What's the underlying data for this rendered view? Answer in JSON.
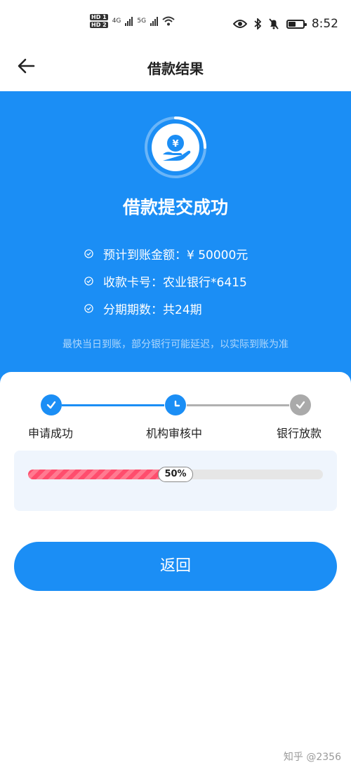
{
  "status_bar": {
    "hd1": "HD 1",
    "hd2": "HD 2",
    "net1": "4G",
    "net2": "5G",
    "time": "8:52",
    "battery_level": 0.45
  },
  "nav": {
    "title": "借款结果",
    "back_icon": "arrow-left-icon"
  },
  "hero": {
    "icon": "yen-hand-icon",
    "title": "借款提交成功",
    "details": [
      {
        "label": "预计到账金额：",
        "value": "¥ 50000元"
      },
      {
        "label": "收款卡号：",
        "value": "农业银行*6415"
      },
      {
        "label": "分期期数：",
        "value": "共24期"
      }
    ],
    "note": "最快当日到账，部分银行可能延迟，以实际到账为准"
  },
  "steps": [
    {
      "label": "申请成功",
      "state": "done",
      "icon": "check-icon"
    },
    {
      "label": "机构审核中",
      "state": "active",
      "icon": "clock-icon"
    },
    {
      "label": "银行放款",
      "state": "pending",
      "icon": "check-icon"
    }
  ],
  "progress": {
    "percent": 50,
    "label": "50%"
  },
  "buttons": {
    "return_label": "返回"
  },
  "watermark": "知乎 @2356",
  "colors": {
    "primary": "#1b8ef5",
    "progress_fill": "#ff4d6d",
    "pending": "#aaaaaa"
  }
}
